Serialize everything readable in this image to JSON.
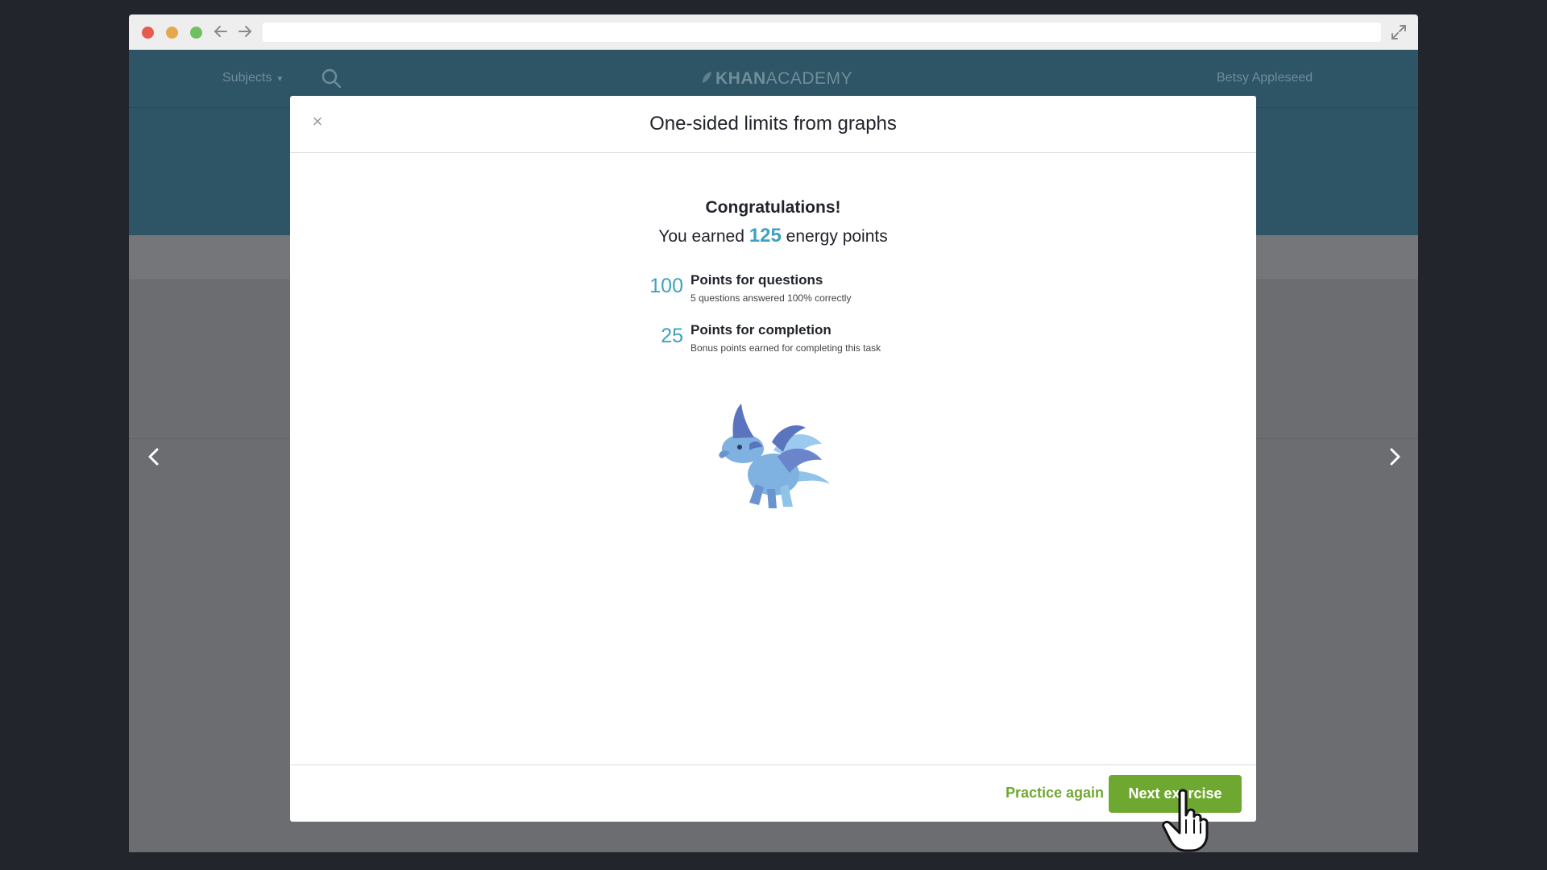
{
  "browser": {
    "back_icon": "arrow-left-icon",
    "forward_icon": "arrow-right-icon",
    "url": "",
    "fullscreen_icon": "expand-icon"
  },
  "header": {
    "subjects_label": "Subjects",
    "logo_text_bold": "KHAN",
    "logo_text_light": "ACADEMY",
    "user_name": "Betsy Appleseed"
  },
  "modal": {
    "title": "One-sided limits from graphs",
    "close_label": "×",
    "congrats": "Congratulations!",
    "earned_prefix": "You earned",
    "earned_points": "125",
    "earned_suffix": "energy points",
    "rows": [
      {
        "points": "100",
        "label": "Points for questions",
        "desc": "5 questions answered 100% correctly"
      },
      {
        "points": "25",
        "label": "Points for completion",
        "desc": "Bonus points earned for completing this task"
      }
    ],
    "practice_again": "Practice again",
    "next_exercise": "Next exercise"
  },
  "colors": {
    "accent_blue": "#3fa1c0",
    "accent_green": "#6fa830",
    "header_bg": "#2e5566"
  }
}
